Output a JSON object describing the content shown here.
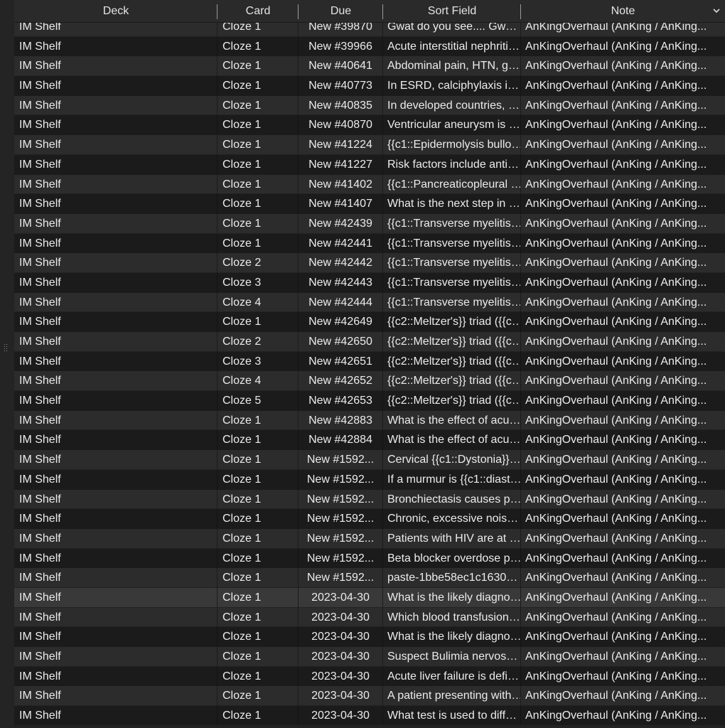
{
  "table": {
    "columns": [
      {
        "key": "deck",
        "label": "Deck"
      },
      {
        "key": "card",
        "label": "Card"
      },
      {
        "key": "due",
        "label": "Due"
      },
      {
        "key": "sort",
        "label": "Sort Field"
      },
      {
        "key": "note",
        "label": "Note"
      }
    ],
    "column_menu_icon": "chevron-down-icon",
    "rows": [
      {
        "deck": "IM Shelf",
        "card": "Cloze 1",
        "due": "New #39870",
        "sort": "Gwat do you see.... Gw…",
        "note": "AnKingOverhaul (AnKing / AnKing...",
        "style": "light"
      },
      {
        "deck": "IM Shelf",
        "card": "Cloze 1",
        "due": "New #39966",
        "sort": "Acute interstitial nephriti…",
        "note": "AnKingOverhaul (AnKing / AnKing...",
        "style": "dark"
      },
      {
        "deck": "IM Shelf",
        "card": "Cloze 1",
        "due": "New #40641",
        "sort": "Abdominal pain, HTN, g…",
        "note": "AnKingOverhaul (AnKing / AnKing...",
        "style": "light"
      },
      {
        "deck": "IM Shelf",
        "card": "Cloze 1",
        "due": "New #40773",
        "sort": "In ESRD, calciphylaxis i…",
        "note": "AnKingOverhaul (AnKing / AnKing...",
        "style": "dark"
      },
      {
        "deck": "IM Shelf",
        "card": "Cloze 1",
        "due": "New #40835",
        "sort": "In developed countries, …",
        "note": "AnKingOverhaul (AnKing / AnKing...",
        "style": "light"
      },
      {
        "deck": "IM Shelf",
        "card": "Cloze 1",
        "due": "New #40870",
        "sort": "Ventricular aneurysm is …",
        "note": "AnKingOverhaul (AnKing / AnKing...",
        "style": "dark"
      },
      {
        "deck": "IM Shelf",
        "card": "Cloze 1",
        "due": "New #41224",
        "sort": "{{c1::Epidermolysis bullo…",
        "note": "AnKingOverhaul (AnKing / AnKing...",
        "style": "light"
      },
      {
        "deck": "IM Shelf",
        "card": "Cloze 1",
        "due": "New #41227",
        "sort": "Risk factors include anti…",
        "note": "AnKingOverhaul (AnKing / AnKing...",
        "style": "dark"
      },
      {
        "deck": "IM Shelf",
        "card": "Cloze 1",
        "due": "New #41402",
        "sort": "{{c1::Pancreaticopleural …",
        "note": "AnKingOverhaul (AnKing / AnKing...",
        "style": "light"
      },
      {
        "deck": "IM Shelf",
        "card": "Cloze 1",
        "due": "New #41407",
        "sort": "What is the next step in …",
        "note": "AnKingOverhaul (AnKing / AnKing...",
        "style": "dark"
      },
      {
        "deck": "IM Shelf",
        "card": "Cloze 1",
        "due": "New #42439",
        "sort": "{{c1::Transverse myelitis…",
        "note": "AnKingOverhaul (AnKing / AnKing...",
        "style": "light"
      },
      {
        "deck": "IM Shelf",
        "card": "Cloze 1",
        "due": "New #42441",
        "sort": "{{c1::Transverse myelitis…",
        "note": "AnKingOverhaul (AnKing / AnKing...",
        "style": "dark"
      },
      {
        "deck": "IM Shelf",
        "card": "Cloze 2",
        "due": "New #42442",
        "sort": "{{c1::Transverse myelitis…",
        "note": "AnKingOverhaul (AnKing / AnKing...",
        "style": "light"
      },
      {
        "deck": "IM Shelf",
        "card": "Cloze 3",
        "due": "New #42443",
        "sort": "{{c1::Transverse myelitis…",
        "note": "AnKingOverhaul (AnKing / AnKing...",
        "style": "dark"
      },
      {
        "deck": "IM Shelf",
        "card": "Cloze 4",
        "due": "New #42444",
        "sort": "{{c1::Transverse myelitis…",
        "note": "AnKingOverhaul (AnKing / AnKing...",
        "style": "light"
      },
      {
        "deck": "IM Shelf",
        "card": "Cloze 1",
        "due": "New #42649",
        "sort": "{{c2::Meltzer's}} triad ({{c…",
        "note": "AnKingOverhaul (AnKing / AnKing...",
        "style": "dark"
      },
      {
        "deck": "IM Shelf",
        "card": "Cloze 2",
        "due": "New #42650",
        "sort": "{{c2::Meltzer's}} triad ({{c…",
        "note": "AnKingOverhaul (AnKing / AnKing...",
        "style": "light"
      },
      {
        "deck": "IM Shelf",
        "card": "Cloze 3",
        "due": "New #42651",
        "sort": "{{c2::Meltzer's}} triad ({{c…",
        "note": "AnKingOverhaul (AnKing / AnKing...",
        "style": "dark"
      },
      {
        "deck": "IM Shelf",
        "card": "Cloze 4",
        "due": "New #42652",
        "sort": "{{c2::Meltzer's}} triad ({{c…",
        "note": "AnKingOverhaul (AnKing / AnKing...",
        "style": "light"
      },
      {
        "deck": "IM Shelf",
        "card": "Cloze 5",
        "due": "New #42653",
        "sort": "{{c2::Meltzer's}} triad ({{c…",
        "note": "AnKingOverhaul (AnKing / AnKing...",
        "style": "dark"
      },
      {
        "deck": "IM Shelf",
        "card": "Cloze 1",
        "due": "New #42883",
        "sort": "What is the effect of acu…",
        "note": "AnKingOverhaul (AnKing / AnKing...",
        "style": "light"
      },
      {
        "deck": "IM Shelf",
        "card": "Cloze 1",
        "due": "New #42884",
        "sort": "What is the effect of acu…",
        "note": "AnKingOverhaul (AnKing / AnKing...",
        "style": "dark"
      },
      {
        "deck": "IM Shelf",
        "card": "Cloze 1",
        "due": "New #1592...",
        "sort": "Cervical {{c1::Dystonia}}…",
        "note": "AnKingOverhaul (AnKing / AnKing...",
        "style": "light"
      },
      {
        "deck": "IM Shelf",
        "card": "Cloze 1",
        "due": "New #1592...",
        "sort": "If a murmur is {{c1::diast…",
        "note": "AnKingOverhaul (AnKing / AnKing...",
        "style": "dark"
      },
      {
        "deck": "IM Shelf",
        "card": "Cloze 1",
        "due": "New #1592...",
        "sort": "Bronchiectasis causes p…",
        "note": "AnKingOverhaul (AnKing / AnKing...",
        "style": "light"
      },
      {
        "deck": "IM Shelf",
        "card": "Cloze 1",
        "due": "New #1592...",
        "sort": "Chronic, excessive nois…",
        "note": "AnKingOverhaul (AnKing / AnKing...",
        "style": "dark"
      },
      {
        "deck": "IM Shelf",
        "card": "Cloze 1",
        "due": "New #1592...",
        "sort": "Patients with HIV are at …",
        "note": "AnKingOverhaul (AnKing / AnKing...",
        "style": "light"
      },
      {
        "deck": "IM Shelf",
        "card": "Cloze 1",
        "due": "New #1592...",
        "sort": "Beta blocker overdose p…",
        "note": "AnKingOverhaul (AnKing / AnKing...",
        "style": "dark"
      },
      {
        "deck": "IM Shelf",
        "card": "Cloze 1",
        "due": "New #1592...",
        "sort": "paste-1bbe58ec1c1630…",
        "note": "AnKingOverhaul (AnKing / AnKing...",
        "style": "light"
      },
      {
        "deck": "IM Shelf",
        "card": "Cloze 1",
        "due": "2023-04-30",
        "sort": "What is the likely diagno…",
        "note": "AnKingOverhaul (AnKing / AnKing...",
        "style": "hl"
      },
      {
        "deck": "IM Shelf",
        "card": "Cloze 1",
        "due": "2023-04-30",
        "sort": "Which blood transfusion…",
        "note": "AnKingOverhaul (AnKing / AnKing...",
        "style": "light"
      },
      {
        "deck": "IM Shelf",
        "card": "Cloze 1",
        "due": "2023-04-30",
        "sort": "What is the likely diagno…",
        "note": "AnKingOverhaul (AnKing / AnKing...",
        "style": "dark"
      },
      {
        "deck": "IM Shelf",
        "card": "Cloze 1",
        "due": "2023-04-30",
        "sort": "Suspect Bulimia nervos…",
        "note": "AnKingOverhaul (AnKing / AnKing...",
        "style": "light"
      },
      {
        "deck": "IM Shelf",
        "card": "Cloze 1",
        "due": "2023-04-30",
        "sort": "Acute liver failure is defi…",
        "note": "AnKingOverhaul (AnKing / AnKing...",
        "style": "dark"
      },
      {
        "deck": "IM Shelf",
        "card": "Cloze 1",
        "due": "2023-04-30",
        "sort": "A patient presenting with…",
        "note": "AnKingOverhaul (AnKing / AnKing...",
        "style": "light"
      },
      {
        "deck": "IM Shelf",
        "card": "Cloze 1",
        "due": "2023-04-30",
        "sort": "What test is used to diff…",
        "note": "AnKingOverhaul (AnKing / AnKing...",
        "style": "dark"
      }
    ]
  },
  "colors": {
    "row_light": "#2c2c2c",
    "row_dark": "#1b1b1b",
    "row_highlight": "#393939",
    "text": "#ececec",
    "header_bg": "#2a2a2a"
  }
}
